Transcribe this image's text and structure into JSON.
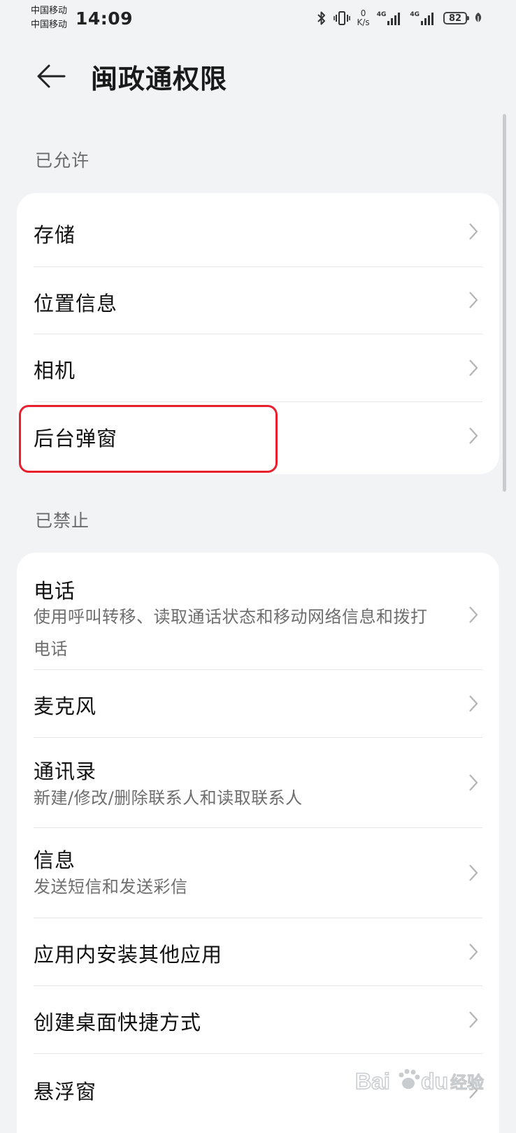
{
  "status_bar": {
    "carrier_1": "中国移动",
    "carrier_2": "中国移动",
    "time": "14:09",
    "speed_value": "0",
    "speed_unit": "K/s",
    "network_1": "4G",
    "network_2": "4G",
    "battery": "82"
  },
  "header": {
    "title": "闽政通权限"
  },
  "sections": {
    "allowed": {
      "label": "已允许",
      "items": [
        {
          "title": "存储"
        },
        {
          "title": "位置信息"
        },
        {
          "title": "相机"
        },
        {
          "title": "后台弹窗"
        }
      ]
    },
    "denied": {
      "label": "已禁止",
      "items": [
        {
          "title": "电话",
          "subtitle": "使用呼叫转移、读取通话状态和移动网络信息和拨打电话"
        },
        {
          "title": "麦克风"
        },
        {
          "title": "通讯录",
          "subtitle": "新建/修改/删除联系人和读取联系人"
        },
        {
          "title": "信息",
          "subtitle": "发送短信和发送彩信"
        },
        {
          "title": "应用内安装其他应用"
        },
        {
          "title": "创建桌面快捷方式"
        },
        {
          "title": "悬浮窗"
        }
      ]
    }
  },
  "colors": {
    "background": "#f1f3f5",
    "card": "#ffffff",
    "highlight": "#e8202e"
  },
  "icons": [
    "back-arrow-icon",
    "bluetooth-icon",
    "vibrate-icon",
    "signal-icon",
    "battery-icon",
    "leaf-icon",
    "chevron-right-icon"
  ]
}
